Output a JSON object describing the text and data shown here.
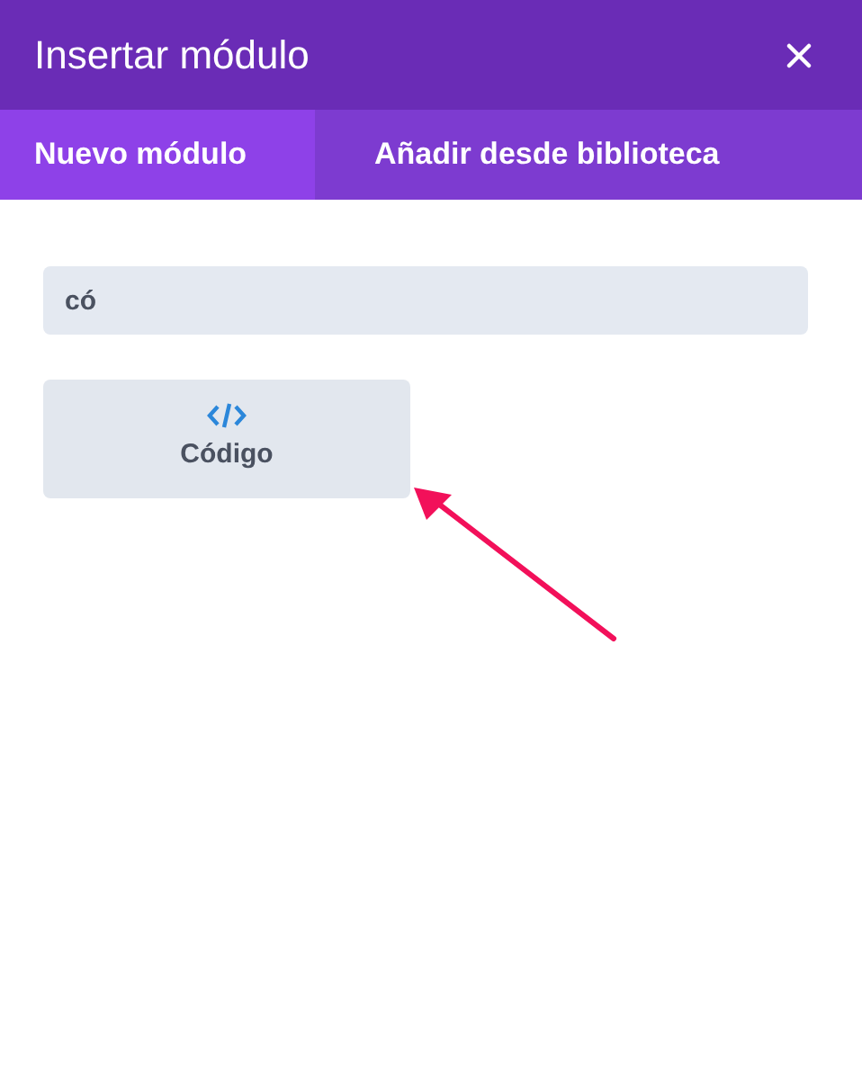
{
  "window": {
    "title": "Insertar módulo"
  },
  "tabs": [
    {
      "label": "Nuevo módulo",
      "selected": true
    },
    {
      "label": "Añadir desde biblioteca",
      "selected": false
    }
  ],
  "search": {
    "value": "có"
  },
  "modules": [
    {
      "label": "Código"
    }
  ]
}
